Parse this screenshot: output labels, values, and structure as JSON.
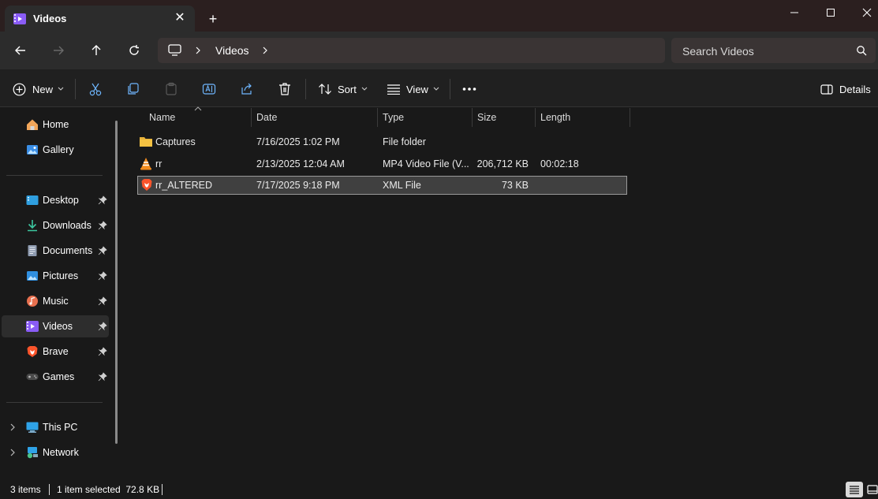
{
  "window": {
    "tab_title": "Videos",
    "tab_close": "✕",
    "new_tab": "+"
  },
  "nav": {
    "breadcrumb": [
      "Videos"
    ],
    "search_placeholder": "Search Videos"
  },
  "toolbar": {
    "new_label": "New",
    "sort_label": "Sort",
    "view_label": "View",
    "details_label": "Details"
  },
  "sidebar": {
    "top": [
      {
        "label": "Home",
        "icon": "home-icon"
      },
      {
        "label": "Gallery",
        "icon": "gallery-icon"
      }
    ],
    "pinned": [
      {
        "label": "Desktop",
        "icon": "desktop-icon"
      },
      {
        "label": "Downloads",
        "icon": "downloads-icon"
      },
      {
        "label": "Documents",
        "icon": "documents-icon"
      },
      {
        "label": "Pictures",
        "icon": "pictures-icon"
      },
      {
        "label": "Music",
        "icon": "music-icon"
      },
      {
        "label": "Videos",
        "icon": "videos-icon",
        "selected": true
      },
      {
        "label": "Brave",
        "icon": "brave-icon"
      },
      {
        "label": "Games",
        "icon": "games-icon"
      }
    ],
    "bottom": [
      {
        "label": "This PC",
        "icon": "this-pc-icon"
      },
      {
        "label": "Network",
        "icon": "network-icon"
      }
    ]
  },
  "table": {
    "columns": [
      "Name",
      "Date",
      "Type",
      "Size",
      "Length"
    ],
    "rows": [
      {
        "name": "Captures",
        "date": "7/16/2025 1:02 PM",
        "type": "File folder",
        "size": "",
        "length": "",
        "icon": "folder-icon"
      },
      {
        "name": "rr",
        "date": "2/13/2025 12:04 AM",
        "type": "MP4 Video File (V...",
        "size": "206,712 KB",
        "length": "00:02:18",
        "icon": "vlc-icon"
      },
      {
        "name": "rr_ALTERED",
        "date": "7/17/2025 9:18 PM",
        "type": "XML File",
        "size": "73 KB",
        "length": "",
        "icon": "brave-file-icon",
        "selected": true
      }
    ]
  },
  "status": {
    "items_count": "3 items",
    "selection": "1 item selected  72.8 KB"
  },
  "colors": {
    "accent_purple": "#8a5cf6",
    "folder_yellow": "#f5c242",
    "brave_orange": "#fb542b"
  }
}
